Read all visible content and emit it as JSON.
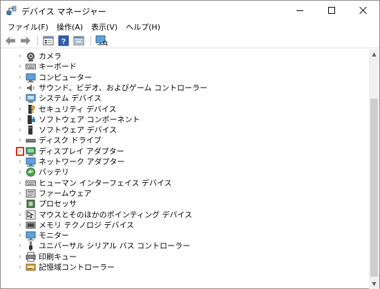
{
  "window": {
    "title": "デバイス マネージャー",
    "app_icon": "device-manager-icon"
  },
  "menu": {
    "items": [
      "ファイル(F)",
      "操作(A)",
      "表示(V)",
      "ヘルプ(H)"
    ]
  },
  "toolbar": {
    "buttons": [
      "back-arrow-icon",
      "forward-arrow-icon",
      "properties-icon",
      "help-icon",
      "view-icon",
      "scan-hardware-icon"
    ]
  },
  "tree": {
    "items": [
      {
        "label": "カメラ",
        "icon": "camera-icon"
      },
      {
        "label": "キーボード",
        "icon": "keyboard-icon"
      },
      {
        "label": "コンピューター",
        "icon": "computer-icon"
      },
      {
        "label": "サウンド、ビデオ、およびゲーム コントローラー",
        "icon": "speaker-icon"
      },
      {
        "label": "システム デバイス",
        "icon": "system-device-icon"
      },
      {
        "label": "セキュリティ デバイス",
        "icon": "security-device-icon"
      },
      {
        "label": "ソフトウェア コンポーネント",
        "icon": "software-component-icon"
      },
      {
        "label": "ソフトウェア デバイス",
        "icon": "software-device-icon"
      },
      {
        "label": "ディスク ドライブ",
        "icon": "disk-drive-icon"
      },
      {
        "label": "ディスプレイ アダプター",
        "icon": "display-adapter-icon",
        "highlighted": true
      },
      {
        "label": "ネットワーク アダプター",
        "icon": "network-adapter-icon"
      },
      {
        "label": "バッテリ",
        "icon": "battery-icon"
      },
      {
        "label": "ヒューマン インターフェイス デバイス",
        "icon": "hid-icon"
      },
      {
        "label": "ファームウェア",
        "icon": "firmware-icon"
      },
      {
        "label": "プロセッサ",
        "icon": "processor-icon"
      },
      {
        "label": "マウスとそのほかのポインティング デバイス",
        "icon": "mouse-icon"
      },
      {
        "label": "メモリ テクノロジ デバイス",
        "icon": "memory-icon"
      },
      {
        "label": "モニター",
        "icon": "monitor-icon"
      },
      {
        "label": "ユニバーサル シリアル バス コントローラー",
        "icon": "usb-icon"
      },
      {
        "label": "印刷キュー",
        "icon": "printer-icon"
      },
      {
        "label": "記憶域コントローラー",
        "icon": "storage-controller-icon"
      }
    ]
  },
  "expander_glyph": "›",
  "colors": {
    "highlight_border": "#e5281e",
    "scroll_thumb": "#cdcdcd"
  }
}
